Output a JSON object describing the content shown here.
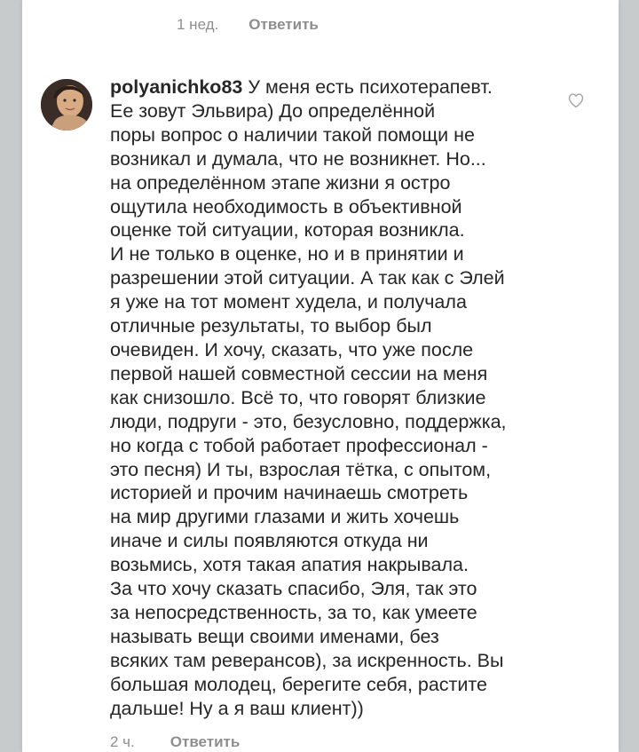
{
  "top_meta": {
    "time": "1 нед.",
    "reply_label": "Ответить"
  },
  "comment": {
    "username": "polyanichko83",
    "text": "У меня есть психотерапевт.\nЕе зовут Эльвира) До определённой\nпоры вопрос о наличии такой помощи не\nвозникал и думала, что не возникнет. Но...\nна определённом этапе жизни я остро\nощутила необходимость в объективной\nоценке той ситуации, которая возникла.\nИ не только в оценке, но и в принятии и\nразрешении этой ситуации. А так как с Элей\nя уже на тот момент худела, и получала\nотличные результаты, то выбор был\nочевиден. И хочу, сказать, что уже после\nпервой нашей совместной сессии на меня\nкак снизошло. Всё то, что говорят близкие\nлюди, подруги -  это, безусловно, поддержка,\nно когда с тобой работает профессионал -\nэто песня) И ты, взрослая тётка, с опытом,\nисторией и прочим начинаешь смотреть\nна  мир другими глазами и жить хочешь\nиначе и силы появляются откуда ни\nвозьмись, хотя такая апатия накрывала.\nЗа что хочу сказать спасибо, Эля, так это\nза непосредственность, за то, как умеете\nназывать вещи своими именами, без\nвсяких там реверансов), за искренность. Вы\nбольшая молодец,  берегите себя, растите\nдальше! Ну а я ваш клиент))",
    "like_icon": "heart-outline-icon"
  },
  "bottom_meta": {
    "time": "2 ч.",
    "reply_label": "Ответить"
  },
  "colors": {
    "background": "#c8cbcc",
    "card": "#ffffff",
    "text": "#262626",
    "muted": "#8e8e8e"
  }
}
